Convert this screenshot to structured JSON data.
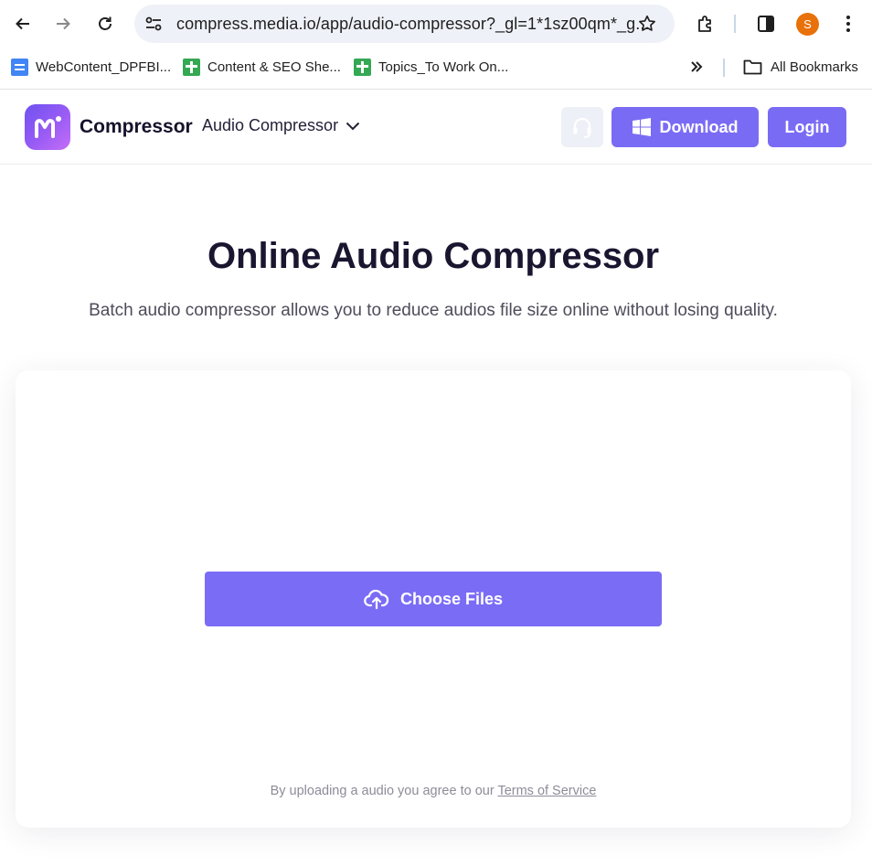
{
  "browser": {
    "url": "compress.media.io/app/audio-compressor?_gl=1*1sz00qm*_g...",
    "profile_initial": "S",
    "bookmarks": [
      {
        "label": "WebContent_DPFBI...",
        "icon": "docs-icon"
      },
      {
        "label": "Content & SEO She...",
        "icon": "sheets-icon"
      },
      {
        "label": "Topics_To Work On...",
        "icon": "sheets-icon"
      }
    ],
    "all_bookmarks_label": "All Bookmarks"
  },
  "header": {
    "brand": "Compressor",
    "product_menu_label": "Audio Compressor",
    "download_label": "Download",
    "login_label": "Login"
  },
  "hero": {
    "title": "Online Audio Compressor",
    "subtitle": "Batch audio compressor allows you to reduce audios file size online without losing quality."
  },
  "upload": {
    "choose_files_label": "Choose Files",
    "agreement_prefix": "By uploading a audio you agree to our",
    "terms_link": "Terms of Service"
  },
  "colors": {
    "accent": "#7a6bf5",
    "profile": "#e8710a"
  }
}
